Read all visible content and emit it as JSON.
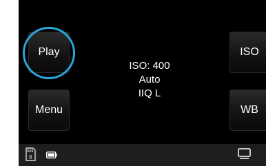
{
  "left_buttons": {
    "play_label": "Play",
    "menu_label": "Menu"
  },
  "right_buttons": {
    "iso_label": "ISO",
    "wb_label": "WB"
  },
  "info": {
    "iso": "ISO: 400",
    "mode": "Auto",
    "quality": "IIQ L"
  },
  "status_bar": {
    "card_icon": "card-slot-icon",
    "battery_icon": "battery-icon",
    "screen_icon": "screen-icon"
  },
  "colors": {
    "screen_background": "#000000",
    "highlight_ring": "#2aa6d9",
    "status_bar": "#1e1e1e",
    "text": "#ffffff"
  }
}
